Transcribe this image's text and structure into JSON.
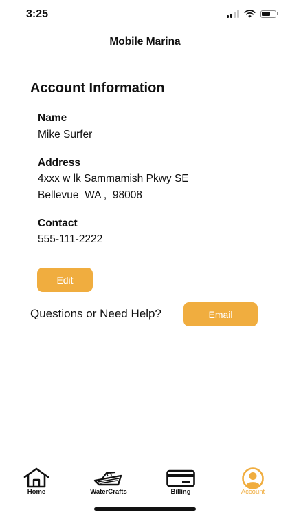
{
  "status_bar": {
    "time": "3:25"
  },
  "nav": {
    "title": "Mobile Marina"
  },
  "account": {
    "section_title": "Account Information",
    "name_label": "Name",
    "name_value": "Mike Surfer",
    "address_label": "Address",
    "address_line1": "4xxx w lk Sammamish Pkwy SE",
    "address_line2": "Bellevue  WA ,  98008",
    "contact_label": "Contact",
    "contact_value": "555-111-2222",
    "edit_label": "Edit"
  },
  "help": {
    "text": "Questions or Need Help?",
    "email_label": "Email"
  },
  "tab_bar": {
    "items": [
      {
        "label": "Home",
        "icon": "home-icon"
      },
      {
        "label": "WaterCrafts",
        "icon": "boat-icon"
      },
      {
        "label": "Billing",
        "icon": "credit-card-icon"
      },
      {
        "label": "Account",
        "icon": "account-icon"
      }
    ],
    "active": "Account"
  },
  "colors": {
    "accent": "#f0ad3f",
    "text": "#111111",
    "background": "#ffffff"
  }
}
